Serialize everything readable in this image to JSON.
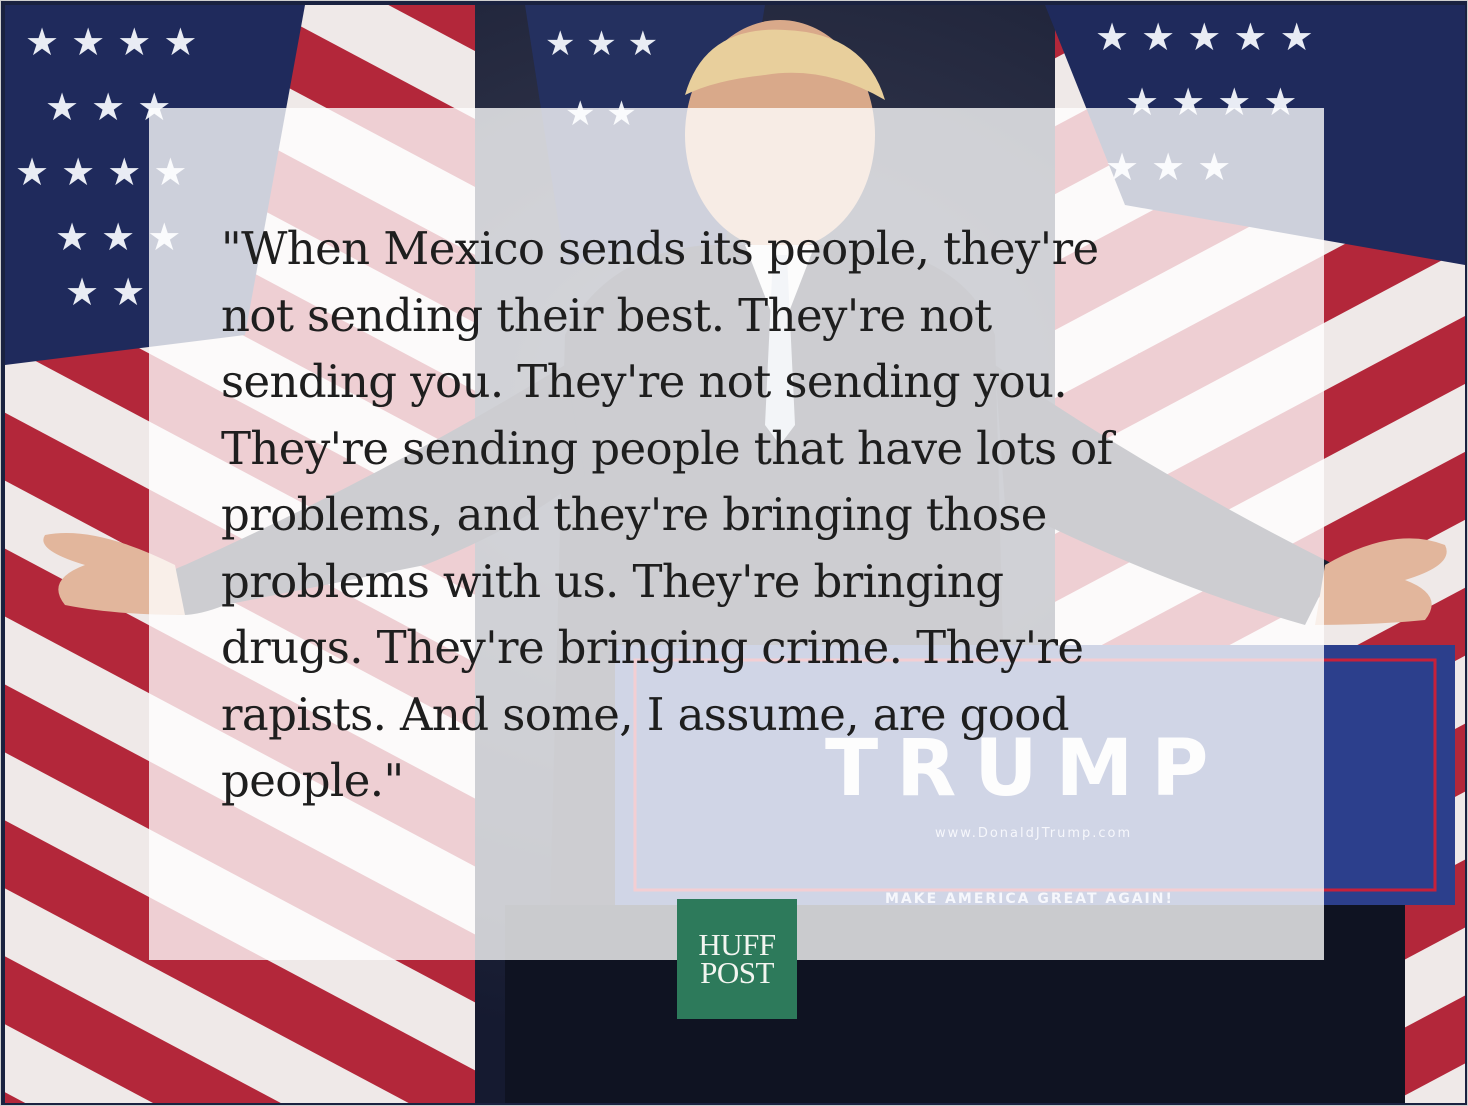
{
  "quote": {
    "text": "\"When Mexico sends its people, they're not sending their best. They're not sending you. They're not sending you. They're sending people that have lots of problems, and they're bringing those problems with us. They're bringing drugs. They're bringing crime. They're rapists. And some, I assume, are good people.\"",
    "lines": [
      "\"When Mexico sends its people, they're",
      "not sending their best. They're not",
      "sending you. They're not sending you.",
      "They're sending people that have lots of",
      "problems, and they're bringing those",
      "problems with us. They're bringing",
      "drugs. They're bringing crime. They're",
      "rapists. And some, I assume, are good",
      "people.\""
    ]
  },
  "background": {
    "podium_sign_title": "TRUMP",
    "podium_sign_url": "www.DonaldJTrump.com",
    "podium_sign_slogan": "MAKE AMERICA GREAT AGAIN!"
  },
  "logo": {
    "line1": "HUFF",
    "line2": "POST",
    "color": "#2d7a5b"
  },
  "colors": {
    "flag_red": "#b3273a",
    "flag_blue": "#1f2a5c",
    "panel_overlay": "rgba(255,255,255,0.78)"
  }
}
